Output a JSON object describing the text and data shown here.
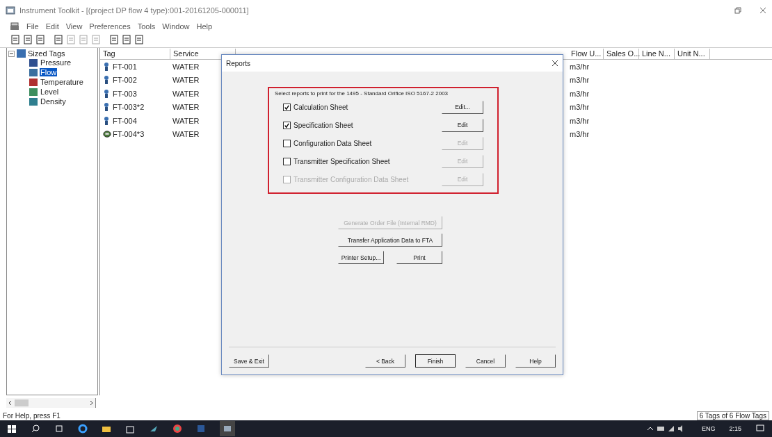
{
  "window": {
    "title": "Instrument Toolkit - [(project DP flow 4 type):001-20161205-000011]"
  },
  "menu": [
    "File",
    "Edit",
    "View",
    "Preferences",
    "Tools",
    "Window",
    "Help"
  ],
  "tree": {
    "label": "Sized Tags",
    "expanded": true,
    "children": [
      {
        "label": "Pressure",
        "selected": false,
        "color": "#2f4f8f"
      },
      {
        "label": "Flow",
        "selected": true,
        "color": "#3a6f9f"
      },
      {
        "label": "Temperature",
        "selected": false,
        "color": "#b03030"
      },
      {
        "label": "Level",
        "selected": false,
        "color": "#3f8f5f"
      },
      {
        "label": "Density",
        "selected": false,
        "color": "#2f7f8f"
      }
    ]
  },
  "table": {
    "columns": [
      "Tag",
      "Service",
      "Flow U...",
      "Sales O...",
      "Line N...",
      "Unit N..."
    ],
    "rows": [
      {
        "kind": "transmitter",
        "tag": "FT-001",
        "service": "WATER",
        "flow_units": "m3/hr"
      },
      {
        "kind": "transmitter",
        "tag": "FT-002",
        "service": "WATER",
        "flow_units": "m3/hr"
      },
      {
        "kind": "transmitter",
        "tag": "FT-003",
        "service": "WATER",
        "flow_units": "m3/hr"
      },
      {
        "kind": "transmitter",
        "tag": "FT-003*2",
        "service": "WATER",
        "flow_units": "m3/hr"
      },
      {
        "kind": "transmitter",
        "tag": "FT-004",
        "service": "WATER",
        "flow_units": "m3/hr"
      },
      {
        "kind": "meter",
        "tag": "FT-004*3",
        "service": "WATER",
        "flow_units": "m3/hr"
      }
    ]
  },
  "dialog": {
    "title": "Reports",
    "prompt": "Select reports to print for the 1495 - Standard Orifice ISO 5167-2 2003",
    "reports": [
      {
        "label": "Calculation Sheet",
        "checked": true,
        "disabled": false,
        "edit": "Edit...",
        "edit_disabled": false
      },
      {
        "label": "Specification Sheet",
        "checked": true,
        "disabled": false,
        "edit": "Edit",
        "edit_disabled": false
      },
      {
        "label": "Configuration Data Sheet",
        "checked": false,
        "disabled": false,
        "edit": "Edit",
        "edit_disabled": true
      },
      {
        "label": "Transmitter Specification Sheet",
        "checked": false,
        "disabled": false,
        "edit": "Edit",
        "edit_disabled": true
      },
      {
        "label": "Transmitter Configuration Data Sheet",
        "checked": false,
        "disabled": true,
        "edit": "Edit",
        "edit_disabled": true
      }
    ],
    "generate_button": {
      "label": "Generate Order File (Internal RMD)",
      "disabled": true
    },
    "transfer_button": {
      "label": "Transfer Application Data to FTA",
      "disabled": false
    },
    "printer_setup_button": "Printer Setup...",
    "print_button": "Print",
    "footer_buttons": [
      {
        "label": "Save & Exit",
        "selected": false
      },
      {
        "label": "< Back",
        "selected": false
      },
      {
        "label": "Finish",
        "selected": true
      },
      {
        "label": "Cancel",
        "selected": false
      },
      {
        "label": "Help",
        "selected": false
      }
    ]
  },
  "status_bar": {
    "help": "For Help, press F1",
    "count": "6 Tags of 6 Flow Tags"
  },
  "taskbar": {
    "language": "ENG",
    "time": "2:15"
  }
}
